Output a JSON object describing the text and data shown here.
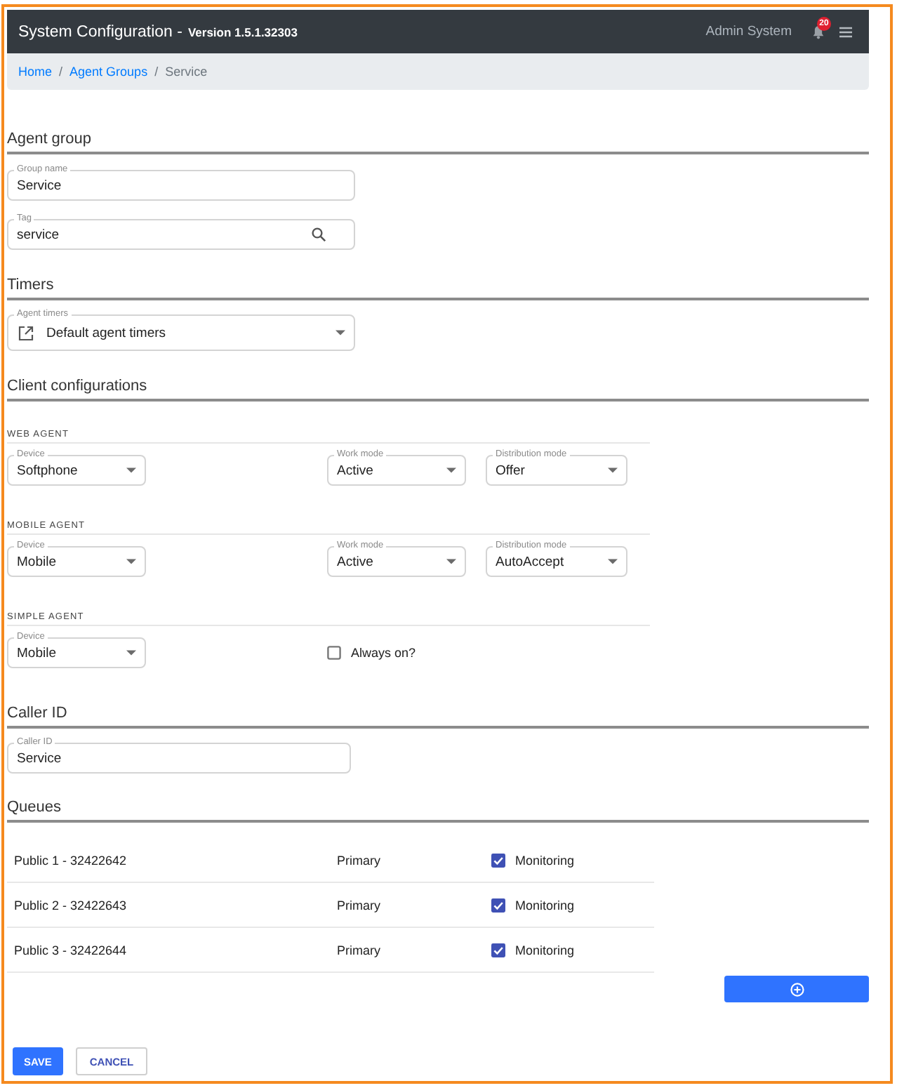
{
  "header": {
    "title": "System Configuration -",
    "version": "Version 1.5.1.32303",
    "user": "Admin System",
    "notifications": "20"
  },
  "breadcrumb": [
    {
      "kind": "link",
      "label": "Home"
    },
    {
      "kind": "separator",
      "label": "/"
    },
    {
      "kind": "link",
      "label": "Agent Groups"
    },
    {
      "kind": "separator",
      "label": "/"
    },
    {
      "kind": "current",
      "label": "Service"
    }
  ],
  "agent_group": {
    "heading": "Agent group",
    "group_name": {
      "label": "Group name",
      "value": "Service"
    },
    "tag": {
      "label": "Tag",
      "value": "service"
    }
  },
  "timers": {
    "heading": "Timers",
    "agent_timers": {
      "label": "Agent timers",
      "value": "Default agent timers"
    }
  },
  "client_configurations": {
    "heading": "Client configurations",
    "agents": [
      {
        "title": "WEB AGENT",
        "fields": [
          {
            "kind": "dropdown",
            "label": "Device",
            "value": "Softphone"
          },
          {
            "kind": "dropdown",
            "label": "Work mode",
            "value": "Active"
          },
          {
            "kind": "dropdown",
            "label": "Distribution mode",
            "value": "Offer"
          }
        ]
      },
      {
        "title": "MOBILE AGENT",
        "fields": [
          {
            "kind": "dropdown",
            "label": "Device",
            "value": "Mobile"
          },
          {
            "kind": "dropdown",
            "label": "Work mode",
            "value": "Active"
          },
          {
            "kind": "dropdown",
            "label": "Distribution mode",
            "value": "AutoAccept"
          }
        ]
      },
      {
        "title": "SIMPLE AGENT",
        "fields": [
          {
            "kind": "dropdown",
            "label": "Device",
            "value": "Mobile"
          },
          {
            "kind": "checkbox",
            "label": "Always on?",
            "checked": false
          }
        ]
      }
    ]
  },
  "caller_id": {
    "heading": "Caller ID",
    "field": {
      "label": "Caller ID",
      "value": "Service"
    }
  },
  "queues": {
    "heading": "Queues",
    "rows": [
      {
        "name": "Public 1 - 32422642",
        "role": "Primary",
        "monitoring": {
          "label": "Monitoring",
          "checked": true
        }
      },
      {
        "name": "Public 2 - 32422643",
        "role": "Primary",
        "monitoring": {
          "label": "Monitoring",
          "checked": true
        }
      },
      {
        "name": "Public 3 - 32422644",
        "role": "Primary",
        "monitoring": {
          "label": "Monitoring",
          "checked": true
        }
      }
    ]
  },
  "actions": [
    {
      "kind": "primary",
      "label": "SAVE"
    },
    {
      "kind": "secondary",
      "label": "CANCEL"
    }
  ]
}
